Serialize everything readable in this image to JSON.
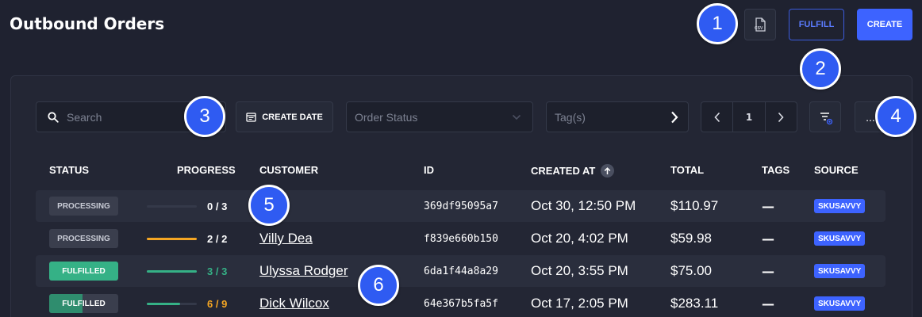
{
  "header": {
    "title": "Outbound Orders",
    "csv_label": "CSV",
    "fulfill_label": "FULFILL",
    "create_label": "CREATE"
  },
  "annotations": [
    "1",
    "2",
    "3",
    "4",
    "5",
    "6"
  ],
  "toolbar": {
    "search_placeholder": "Search",
    "create_date_label": "CREATE DATE",
    "order_status_placeholder": "Order Status",
    "tags_placeholder": "Tag(s)",
    "page_number": "1",
    "more_label": "..."
  },
  "table": {
    "columns": [
      "STATUS",
      "PROGRESS",
      "CUSTOMER",
      "ID",
      "CREATED AT",
      "TOTAL",
      "TAGS",
      "SOURCE"
    ],
    "rows": [
      {
        "status": "PROCESSING",
        "status_kind": "processing",
        "progress_text": "0 / 3",
        "progress_fraction": 0.0,
        "progress_color": "#ffffff",
        "bar_color": "#343949",
        "customer": "",
        "id": "369df95095a7",
        "created_at": "Oct 30, 12:50 PM",
        "total": "$110.97",
        "tags": "—",
        "source": "SKUSAVVY"
      },
      {
        "status": "PROCESSING",
        "status_kind": "processing",
        "progress_text": "2 / 2",
        "progress_fraction": 1.0,
        "progress_color": "#ffffff",
        "bar_color": "#f5a623",
        "customer": "Villy Dea",
        "id": "f839e660b150",
        "created_at": "Oct 20, 4:02 PM",
        "total": "$59.98",
        "tags": "—",
        "source": "SKUSAVVY"
      },
      {
        "status": "FULFILLED",
        "status_kind": "fulfilled",
        "progress_text": "3 / 3",
        "progress_fraction": 1.0,
        "progress_color": "#35b186",
        "bar_color": "#35b186",
        "customer": "Ulyssa Rodger",
        "id": "6da1f44a8a29",
        "created_at": "Oct 20, 3:55 PM",
        "total": "$75.00",
        "tags": "—",
        "source": "SKUSAVVY"
      },
      {
        "status": "FULFILLED",
        "status_kind": "partial",
        "status_fill_fraction": 0.48,
        "progress_text": "6 / 9",
        "progress_fraction": 0.67,
        "progress_color": "#f5a623",
        "bar_color": "#35b186",
        "customer": "Dick Wilcox",
        "id": "64e367b5fa5f",
        "created_at": "Oct 17, 2:05 PM",
        "total": "$283.11",
        "tags": "—",
        "source": "SKUSAVVY"
      }
    ]
  },
  "colors": {
    "accent": "#3d63ff",
    "badge": "#2f5bf2",
    "fulfilled": "#35b186",
    "warning": "#f5a623"
  }
}
